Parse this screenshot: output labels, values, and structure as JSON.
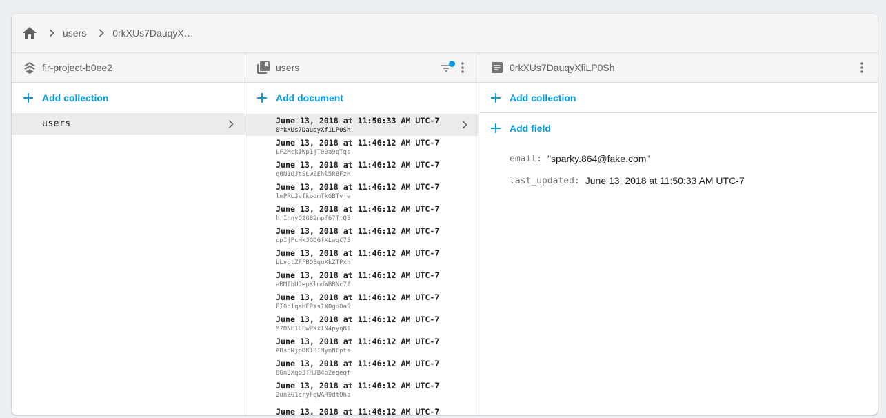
{
  "breadcrumb": {
    "home_icon": "home-icon",
    "items": [
      "users",
      "0rkXUs7DauqyX…"
    ]
  },
  "colors": {
    "accent": "#039be5",
    "filter_badge": "#039be5",
    "selected_row": "#ebebeb",
    "header_bg": "#f5f5f5"
  },
  "panels": {
    "root": {
      "icon": "firestore-stack-icon",
      "title": "fir-project-b0ee2",
      "add_label": "Add collection",
      "collections": [
        {
          "name": "users",
          "selected": true
        }
      ]
    },
    "collection": {
      "icon": "collection-icon",
      "title": "users",
      "add_label": "Add document",
      "documents": [
        {
          "title": "June 13, 2018 at 11:50:33 AM UTC-7",
          "id": "0rkXUs7DauqyXf1LP0Sh",
          "selected": true
        },
        {
          "title": "June 13, 2018 at 11:46:12 AM UTC-7",
          "id": "LF2MckIWp1jT00a9qTqs"
        },
        {
          "title": "June 13, 2018 at 11:46:12 AM UTC-7",
          "id": "q0N1OJtSLwZEhl5RBFzH"
        },
        {
          "title": "June 13, 2018 at 11:46:12 AM UTC-7",
          "id": "lmPRLJvfkodmTkGBTvje"
        },
        {
          "title": "June 13, 2018 at 11:46:12 AM UTC-7",
          "id": "hrIhnyO2GB2mpf67TtQ3"
        },
        {
          "title": "June 13, 2018 at 11:46:12 AM UTC-7",
          "id": "cpIjPcHkJGD6fXLwgC73"
        },
        {
          "title": "June 13, 2018 at 11:46:12 AM UTC-7",
          "id": "bLvqtZFFBOEquXkZTPxn"
        },
        {
          "title": "June 13, 2018 at 11:46:12 AM UTC-7",
          "id": "aBMfhUJepKlmdWBBNc7Z"
        },
        {
          "title": "June 13, 2018 at 11:46:12 AM UTC-7",
          "id": "PI0h1qsHEPXs1XOgH0a9"
        },
        {
          "title": "June 13, 2018 at 11:46:12 AM UTC-7",
          "id": "M7ONE1LEwPXxIN4pyqN1"
        },
        {
          "title": "June 13, 2018 at 11:46:12 AM UTC-7",
          "id": "ABsnNjpDK181MynNFpts"
        },
        {
          "title": "June 13, 2018 at 11:46:12 AM UTC-7",
          "id": "8GnSXqb3THJB4o2eqeqf"
        },
        {
          "title": "June 13, 2018 at 11:46:12 AM UTC-7",
          "id": "2unZG1cryFqWAR9dtOha"
        },
        {
          "title": "June 13, 2018 at 11:46:12 AM UTC-7",
          "id": ""
        }
      ]
    },
    "document": {
      "icon": "document-icon",
      "title": "0rkXUs7DauqyXfiLP0Sh",
      "add_collection_label": "Add collection",
      "add_field_label": "Add field",
      "fields": [
        {
          "key": "email:",
          "value": "\"sparky.864@fake.com\""
        },
        {
          "key": "last_updated:",
          "value": "June 13, 2018 at 11:50:33 AM UTC-7"
        }
      ]
    }
  }
}
